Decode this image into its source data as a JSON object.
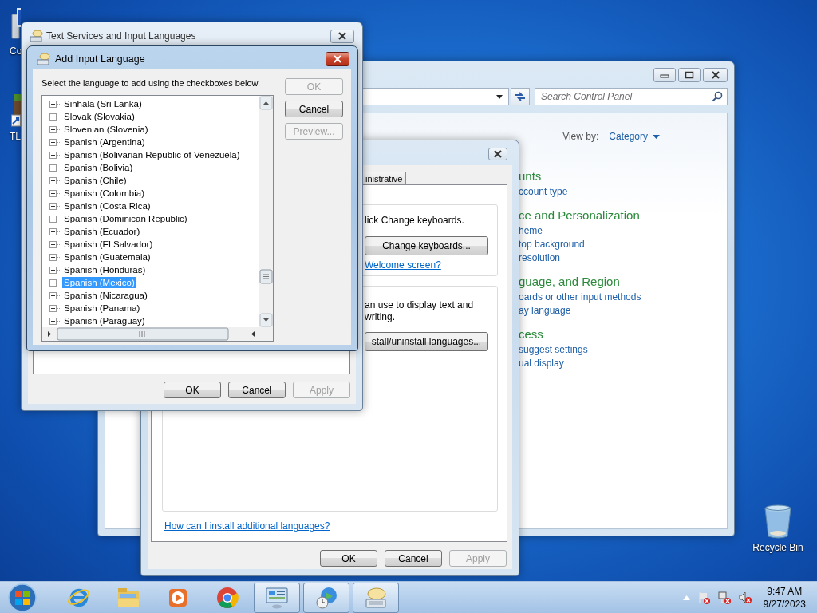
{
  "desktop": {
    "icons": [
      {
        "kind": "computer",
        "label": "Co"
      },
      {
        "kind": "game",
        "label": "TL"
      },
      {
        "kind": "recycle_bin",
        "label": "Recycle Bin"
      }
    ]
  },
  "control_panel": {
    "search": {
      "placeholder": "Search Control Panel"
    },
    "view_by_label": "View by:",
    "view_by_value": "Category",
    "categories": [
      {
        "heading": "unts",
        "links": [
          "ccount type"
        ]
      },
      {
        "heading": "ce and Personalization",
        "links": [
          "heme",
          "top background",
          "resolution"
        ]
      },
      {
        "heading": "guage, and Region",
        "links": [
          "oards or other input methods",
          "ay language"
        ]
      },
      {
        "heading": "cess",
        "links": [
          "suggest settings",
          "ual display"
        ]
      }
    ]
  },
  "region_dialog": {
    "tabs": [
      {
        "label": "inistrative",
        "selected": false
      }
    ],
    "keyboards_text": "lick Change keyboards.",
    "change_keyboards_button": "Change keyboards...",
    "welcome_link": "Welcome screen?",
    "display_lines": [
      "an use to display text and",
      "writing."
    ],
    "install_button": "stall/uninstall languages...",
    "help_link": "How can I install additional languages?",
    "buttons": [
      {
        "label": "OK",
        "disabled": false
      },
      {
        "label": "Cancel",
        "disabled": false
      },
      {
        "label": "Apply",
        "disabled": true
      }
    ]
  },
  "text_services": {
    "title": "Text Services and Input Languages",
    "buttons": [
      {
        "label": "OK",
        "disabled": false
      },
      {
        "label": "Cancel",
        "disabled": false
      },
      {
        "label": "Apply",
        "disabled": true
      }
    ]
  },
  "add_language": {
    "title": "Add Input Language",
    "instruction": "Select the language to add using the checkboxes below.",
    "languages": [
      {
        "label": "Sinhala (Sri Lanka)",
        "expanded": false,
        "selected": false
      },
      {
        "label": "Slovak (Slovakia)",
        "expanded": false,
        "selected": false
      },
      {
        "label": "Slovenian (Slovenia)",
        "expanded": false,
        "selected": false
      },
      {
        "label": "Spanish (Argentina)",
        "expanded": false,
        "selected": false
      },
      {
        "label": "Spanish (Bolivarian Republic of Venezuela)",
        "expanded": false,
        "selected": false
      },
      {
        "label": "Spanish (Bolivia)",
        "expanded": false,
        "selected": false
      },
      {
        "label": "Spanish (Chile)",
        "expanded": false,
        "selected": false
      },
      {
        "label": "Spanish (Colombia)",
        "expanded": false,
        "selected": false
      },
      {
        "label": "Spanish (Costa Rica)",
        "expanded": false,
        "selected": false
      },
      {
        "label": "Spanish (Dominican Republic)",
        "expanded": false,
        "selected": false
      },
      {
        "label": "Spanish (Ecuador)",
        "expanded": false,
        "selected": false
      },
      {
        "label": "Spanish (El Salvador)",
        "expanded": false,
        "selected": false
      },
      {
        "label": "Spanish (Guatemala)",
        "expanded": false,
        "selected": false
      },
      {
        "label": "Spanish (Honduras)",
        "expanded": false,
        "selected": false
      },
      {
        "label": "Spanish (Mexico)",
        "expanded": false,
        "selected": true
      },
      {
        "label": "Spanish (Nicaragua)",
        "expanded": false,
        "selected": false
      },
      {
        "label": "Spanish (Panama)",
        "expanded": false,
        "selected": false
      },
      {
        "label": "Spanish (Paraguay)",
        "expanded": false,
        "selected": false
      }
    ],
    "buttons": [
      {
        "label": "OK",
        "disabled": true
      },
      {
        "label": "Cancel",
        "disabled": false
      },
      {
        "label": "Preview...",
        "disabled": true
      }
    ]
  },
  "taskbar": {
    "apps": [
      {
        "kind": "ie",
        "active": false
      },
      {
        "kind": "explorer",
        "active": false
      },
      {
        "kind": "media",
        "active": false
      },
      {
        "kind": "chrome",
        "active": false
      },
      {
        "kind": "control_panel",
        "active": true
      },
      {
        "kind": "region",
        "active": true
      },
      {
        "kind": "keyboard",
        "active": true
      }
    ],
    "clock": {
      "time": "9:47 AM",
      "date": "9/27/2023"
    }
  }
}
